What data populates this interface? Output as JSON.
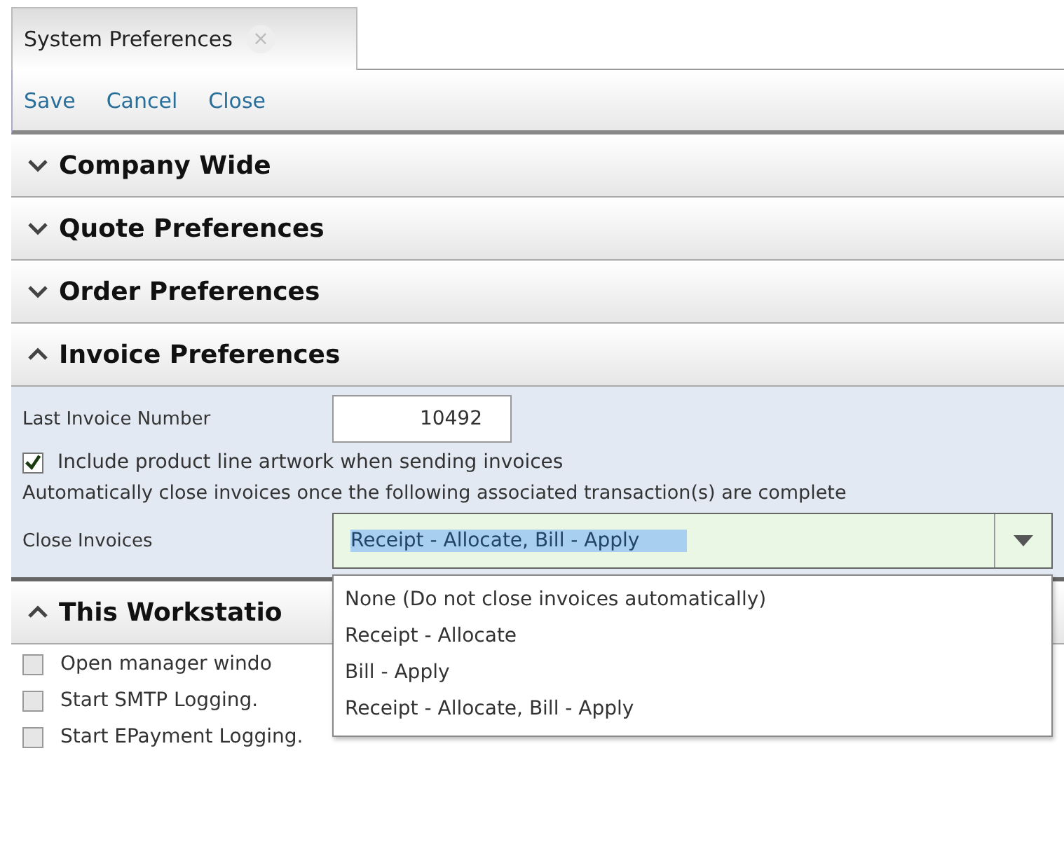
{
  "tab": {
    "label": "System Preferences",
    "close": "×"
  },
  "toolbar": [
    "Save",
    "Cancel",
    "Close"
  ],
  "sections": [
    {
      "title": "Company Wide",
      "expanded": false
    },
    {
      "title": "Quote Preferences",
      "expanded": false
    },
    {
      "title": "Order Preferences",
      "expanded": false
    },
    {
      "title": "Invoice Preferences",
      "expanded": true
    }
  ],
  "invoice": {
    "last_number_label": "Last Invoice Number",
    "last_number": "10492",
    "include_artwork": {
      "label": "Include product line artwork when sending invoices",
      "checked": true
    },
    "auto_close_note": "Automatically close invoices once the following associated transaction(s) are complete",
    "close_label": "Close Invoices",
    "close_value": "Receipt - Allocate, Bill - Apply",
    "dropdown_open": true,
    "options": [
      "None (Do not close invoices automatically)",
      "Receipt - Allocate",
      "Bill - Apply",
      "Receipt - Allocate, Bill - Apply"
    ]
  },
  "workstation": {
    "title": "This Workstatio",
    "expanded": true,
    "items": [
      {
        "label": "Open manager windo",
        "checked": false
      },
      {
        "label": "Start SMTP Logging.",
        "checked": false
      },
      {
        "label": "Start EPayment Logging.",
        "checked": false
      }
    ]
  }
}
